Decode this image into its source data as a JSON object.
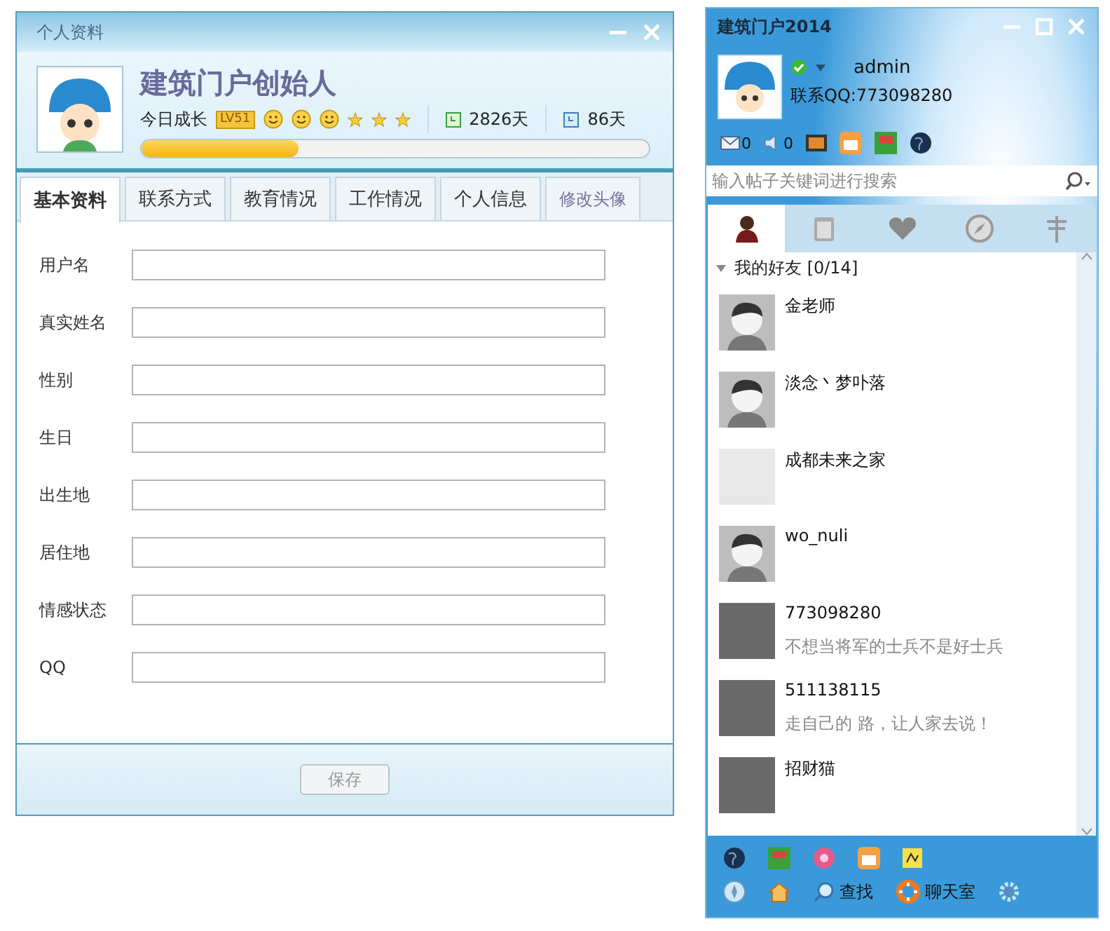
{
  "profile_window": {
    "title": "个人资料",
    "name": "建筑门户创始人",
    "growth_label": "今日成长",
    "level_badge": "LV51",
    "days_total": "2826天",
    "days_active": "86天",
    "growth": {
      "level": 0.31
    },
    "tabs": [
      {
        "label": "基本资料",
        "selected": true,
        "kind": "tab"
      },
      {
        "label": "联系方式",
        "selected": false,
        "kind": "tab"
      },
      {
        "label": "教育情况",
        "selected": false,
        "kind": "tab"
      },
      {
        "label": "工作情况",
        "selected": false,
        "kind": "tab"
      },
      {
        "label": "个人信息",
        "selected": false,
        "kind": "tab"
      },
      {
        "label": "修改头像",
        "selected": false,
        "kind": "action"
      }
    ],
    "fields": [
      {
        "label": "用户名"
      },
      {
        "label": "真实姓名"
      },
      {
        "label": "性别"
      },
      {
        "label": "生日"
      },
      {
        "label": "出生地"
      },
      {
        "label": "居住地"
      },
      {
        "label": "情感状态"
      },
      {
        "label": "QQ"
      }
    ],
    "save_button": {
      "label": "保存",
      "disabled": true
    }
  },
  "messenger_window": {
    "title": "建筑门户2014",
    "username": "admin",
    "online": true,
    "contact": "联系QQ:773098280",
    "mail_count": "0",
    "sound_count": "0",
    "search": {
      "placeholder": "输入帖子关键词进行搜索"
    },
    "tabs": [
      {
        "selected": true
      },
      {
        "selected": false
      },
      {
        "selected": false
      },
      {
        "selected": false
      },
      {
        "selected": false
      }
    ],
    "group": {
      "label": "我的好友 [0/14]",
      "expanded": true
    },
    "friends": [
      {
        "name": "金老师",
        "kind": "cartoon"
      },
      {
        "name": "淡念丶梦卟落",
        "kind": "cartoon"
      },
      {
        "name": "成都未来之家",
        "kind": "logo"
      },
      {
        "name": "wo_nuli",
        "kind": "cartoon"
      },
      {
        "name": "773098280",
        "signature": "不想当将军的士兵不是好士兵",
        "kind": "photo"
      },
      {
        "name": "511138115",
        "signature": "走自己的 路，让人家去说！",
        "kind": "photo"
      },
      {
        "name": "招财猫",
        "kind": "photo"
      }
    ],
    "bottom_buttons": [
      {
        "label": "查找",
        "kind": "search"
      },
      {
        "label": "聊天室",
        "kind": "chat"
      }
    ]
  }
}
